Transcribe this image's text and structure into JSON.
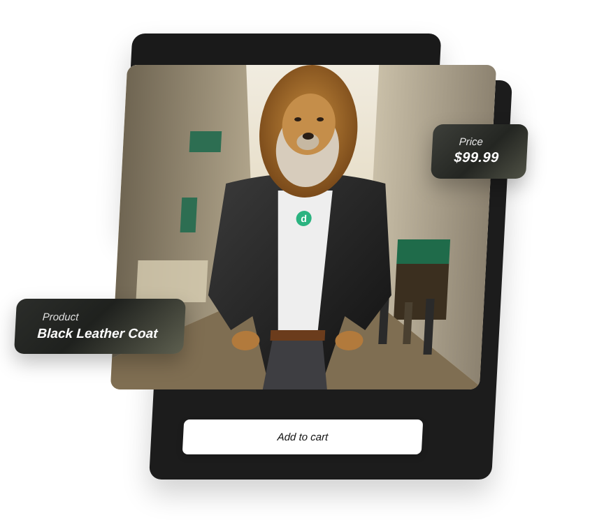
{
  "price": {
    "label": "Price",
    "value": "$99.99"
  },
  "product": {
    "label": "Product",
    "value": "Black Leather Coat"
  },
  "cart": {
    "button_label": "Add to cart"
  },
  "image": {
    "alt": "Lion in black leather jacket on city street",
    "shirt_logo": "d"
  },
  "colors": {
    "panel": "#1a1a1a",
    "accent_green": "#2bb380",
    "card_dark": "#2a2c28",
    "button_bg": "#ffffff"
  }
}
